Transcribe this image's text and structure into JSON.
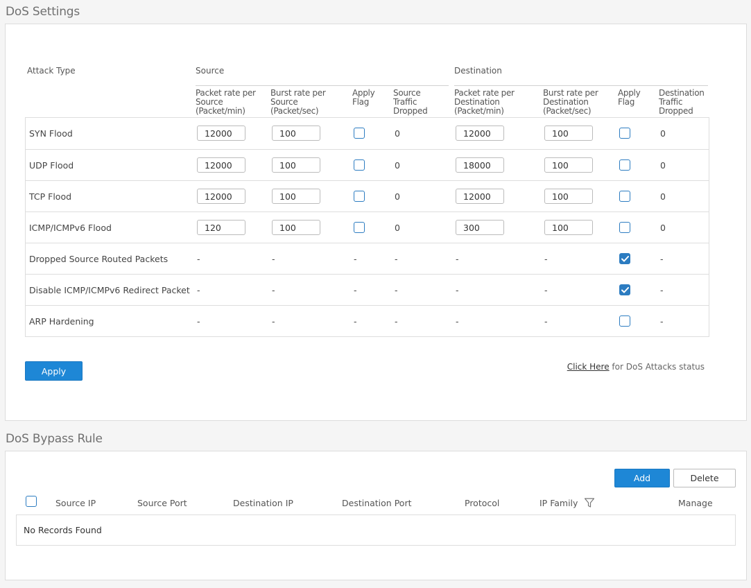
{
  "dos_settings": {
    "title": "DoS Settings",
    "headers": {
      "attack_type": "Attack Type",
      "source": "Source",
      "destination": "Destination",
      "src_packet_rate": [
        "Packet rate per",
        "Source",
        "(Packet/min)"
      ],
      "src_burst_rate": [
        "Burst rate per",
        "Source",
        "(Packet/sec)"
      ],
      "src_apply_flag": [
        "Apply",
        "Flag"
      ],
      "src_dropped": [
        "Source",
        "Traffic",
        "Dropped"
      ],
      "dst_packet_rate": [
        "Packet rate per",
        "Destination",
        "(Packet/min)"
      ],
      "dst_burst_rate": [
        "Burst rate per",
        "Destination",
        "(Packet/sec)"
      ],
      "dst_apply_flag": [
        "Apply",
        "Flag"
      ],
      "dst_dropped": [
        "Destination",
        "Traffic",
        "Dropped"
      ]
    },
    "rows": [
      {
        "name": "SYN Flood",
        "src_rate": "12000",
        "src_burst": "100",
        "src_flag": false,
        "src_dropped": "0",
        "dst_rate": "12000",
        "dst_burst": "100",
        "dst_flag": false,
        "dst_dropped": "0"
      },
      {
        "name": "UDP Flood",
        "src_rate": "12000",
        "src_burst": "100",
        "src_flag": false,
        "src_dropped": "0",
        "dst_rate": "18000",
        "dst_burst": "100",
        "dst_flag": false,
        "dst_dropped": "0"
      },
      {
        "name": "TCP Flood",
        "src_rate": "12000",
        "src_burst": "100",
        "src_flag": false,
        "src_dropped": "0",
        "dst_rate": "12000",
        "dst_burst": "100",
        "dst_flag": false,
        "dst_dropped": "0"
      },
      {
        "name": "ICMP/ICMPv6 Flood",
        "src_rate": "120",
        "src_burst": "100",
        "src_flag": false,
        "src_dropped": "0",
        "dst_rate": "300",
        "dst_burst": "100",
        "dst_flag": false,
        "dst_dropped": "0"
      },
      {
        "name": "Dropped Source Routed Packets",
        "src_rate": "-",
        "src_burst": "-",
        "src_flag": "-",
        "src_dropped": "-",
        "dst_rate": "-",
        "dst_burst": "-",
        "dst_flag": true,
        "dst_dropped": "-"
      },
      {
        "name": "Disable ICMP/ICMPv6 Redirect Packet",
        "src_rate": "-",
        "src_burst": "-",
        "src_flag": "-",
        "src_dropped": "-",
        "dst_rate": "-",
        "dst_burst": "-",
        "dst_flag": true,
        "dst_dropped": "-"
      },
      {
        "name": "ARP Hardening",
        "src_rate": "-",
        "src_burst": "-",
        "src_flag": "-",
        "src_dropped": "-",
        "dst_rate": "-",
        "dst_burst": "-",
        "dst_flag": false,
        "dst_dropped": "-"
      }
    ],
    "apply_label": "Apply",
    "status_link_text": "Click Here",
    "status_suffix": " for DoS Attacks status"
  },
  "bypass": {
    "title": "DoS Bypass Rule",
    "add_label": "Add",
    "delete_label": "Delete",
    "columns": {
      "source_ip": "Source IP",
      "source_port": "Source Port",
      "destination_ip": "Destination IP",
      "destination_port": "Destination Port",
      "protocol": "Protocol",
      "ip_family": "IP Family",
      "manage": "Manage"
    },
    "empty_text": "No Records Found"
  },
  "colors": {
    "accent": "#1e87d6",
    "checkbox": "#2c7cc1",
    "background": "#f5f5f5"
  }
}
